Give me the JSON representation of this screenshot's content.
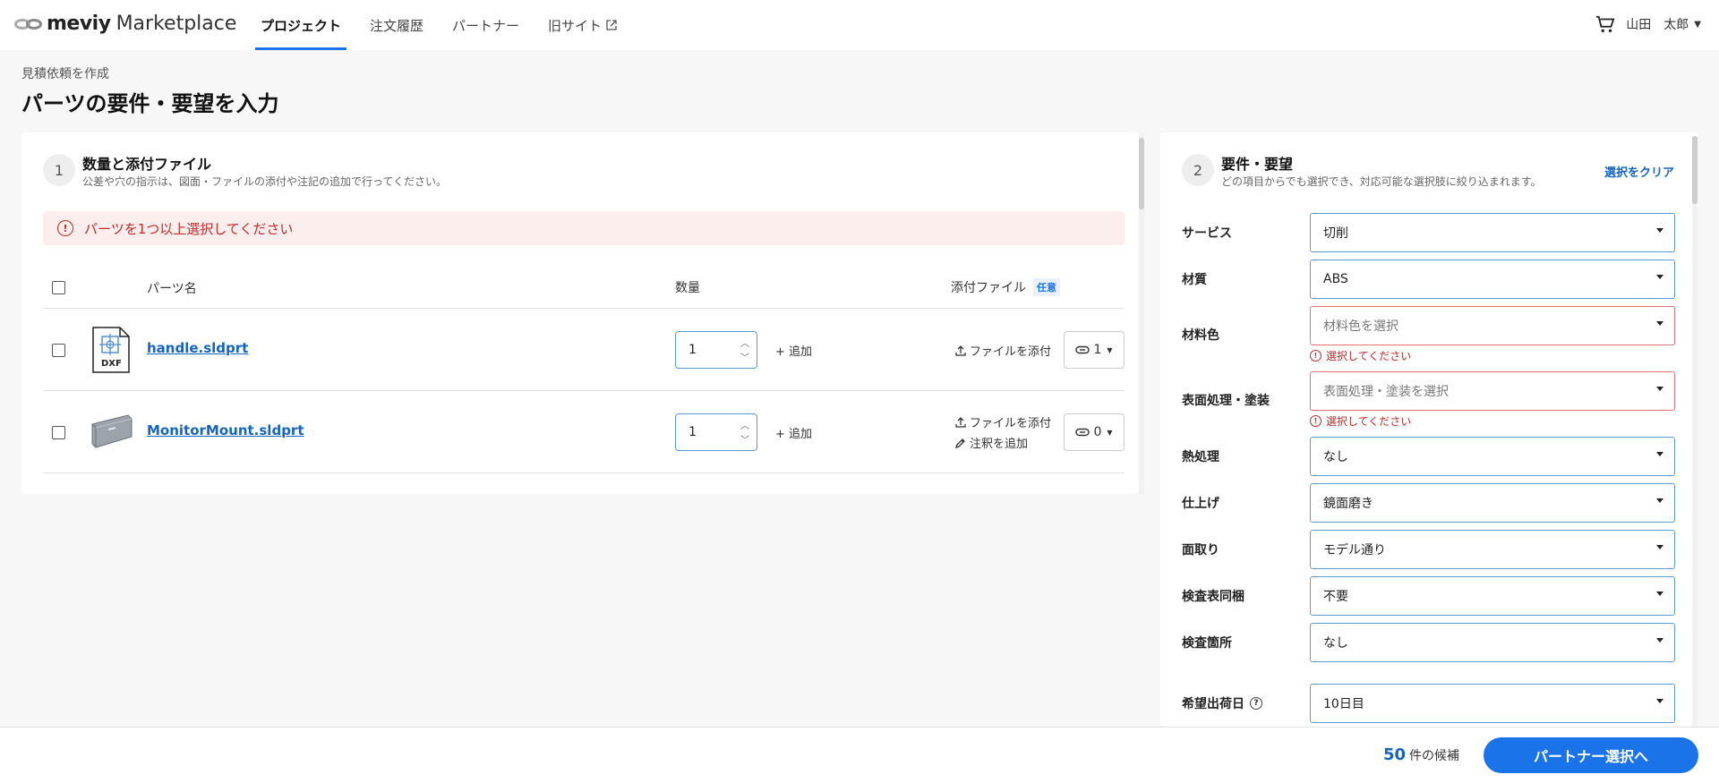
{
  "header": {
    "logo_brand": "meviy",
    "logo_suffix": "Marketplace",
    "nav": [
      {
        "label": "プロジェクト"
      },
      {
        "label": "注文履歴"
      },
      {
        "label": "パートナー"
      },
      {
        "label": "旧サイト"
      }
    ],
    "user_name": "山田　太郎"
  },
  "page": {
    "breadcrumb": "見積依頼を作成",
    "title": "パーツの要件・要望を入力"
  },
  "section1": {
    "step": "1",
    "title": "数量と添付ファイル",
    "subtitle": "公差や穴の指示は、図面・ファイルの添付や注記の追加で行ってください。",
    "alert": "パーツを1つ以上選択してください",
    "columns": {
      "part_name": "パーツ名",
      "quantity": "数量",
      "attachments": "添付ファイル",
      "optional_badge": "任意"
    },
    "rows": [
      {
        "name": "handle.sldprt",
        "thumb_label": "DXF",
        "qty": "1",
        "add": "追加",
        "attach": "ファイルを添付",
        "note": "",
        "clip_count": "1"
      },
      {
        "name": "MonitorMount.sldprt",
        "thumb_label": "",
        "qty": "1",
        "add": "追加",
        "attach": "ファイルを添付",
        "note": "注釈を追加",
        "clip_count": "0"
      }
    ]
  },
  "section2": {
    "step": "2",
    "title": "要件・要望",
    "subtitle": "どの項目からでも選択でき、対応可能な選択肢に絞り込まれます。",
    "clear": "選択をクリア",
    "error_text": "選択してください",
    "fields": [
      {
        "label": "サービス",
        "value": "切削"
      },
      {
        "label": "材質",
        "value": "ABS"
      },
      {
        "label": "材料色",
        "value": "材料色を選択"
      },
      {
        "label": "表面処理・塗装",
        "value": "表面処理・塗装を選択"
      },
      {
        "label": "熱処理",
        "value": "なし"
      },
      {
        "label": "仕上げ",
        "value": "鏡面磨き"
      },
      {
        "label": "面取り",
        "value": "モデル通り"
      },
      {
        "label": "検査表同梱",
        "value": "不要"
      },
      {
        "label": "検査箇所",
        "value": "なし"
      },
      {
        "label": "希望出荷日",
        "value": "10日目"
      }
    ]
  },
  "footer": {
    "candidate_count": "50",
    "candidate_suffix": "件の候補",
    "next_button": "パートナー選択へ"
  },
  "colors": {
    "accent": "#1a73e8",
    "error": "#c62828",
    "link": "#1565c0"
  }
}
